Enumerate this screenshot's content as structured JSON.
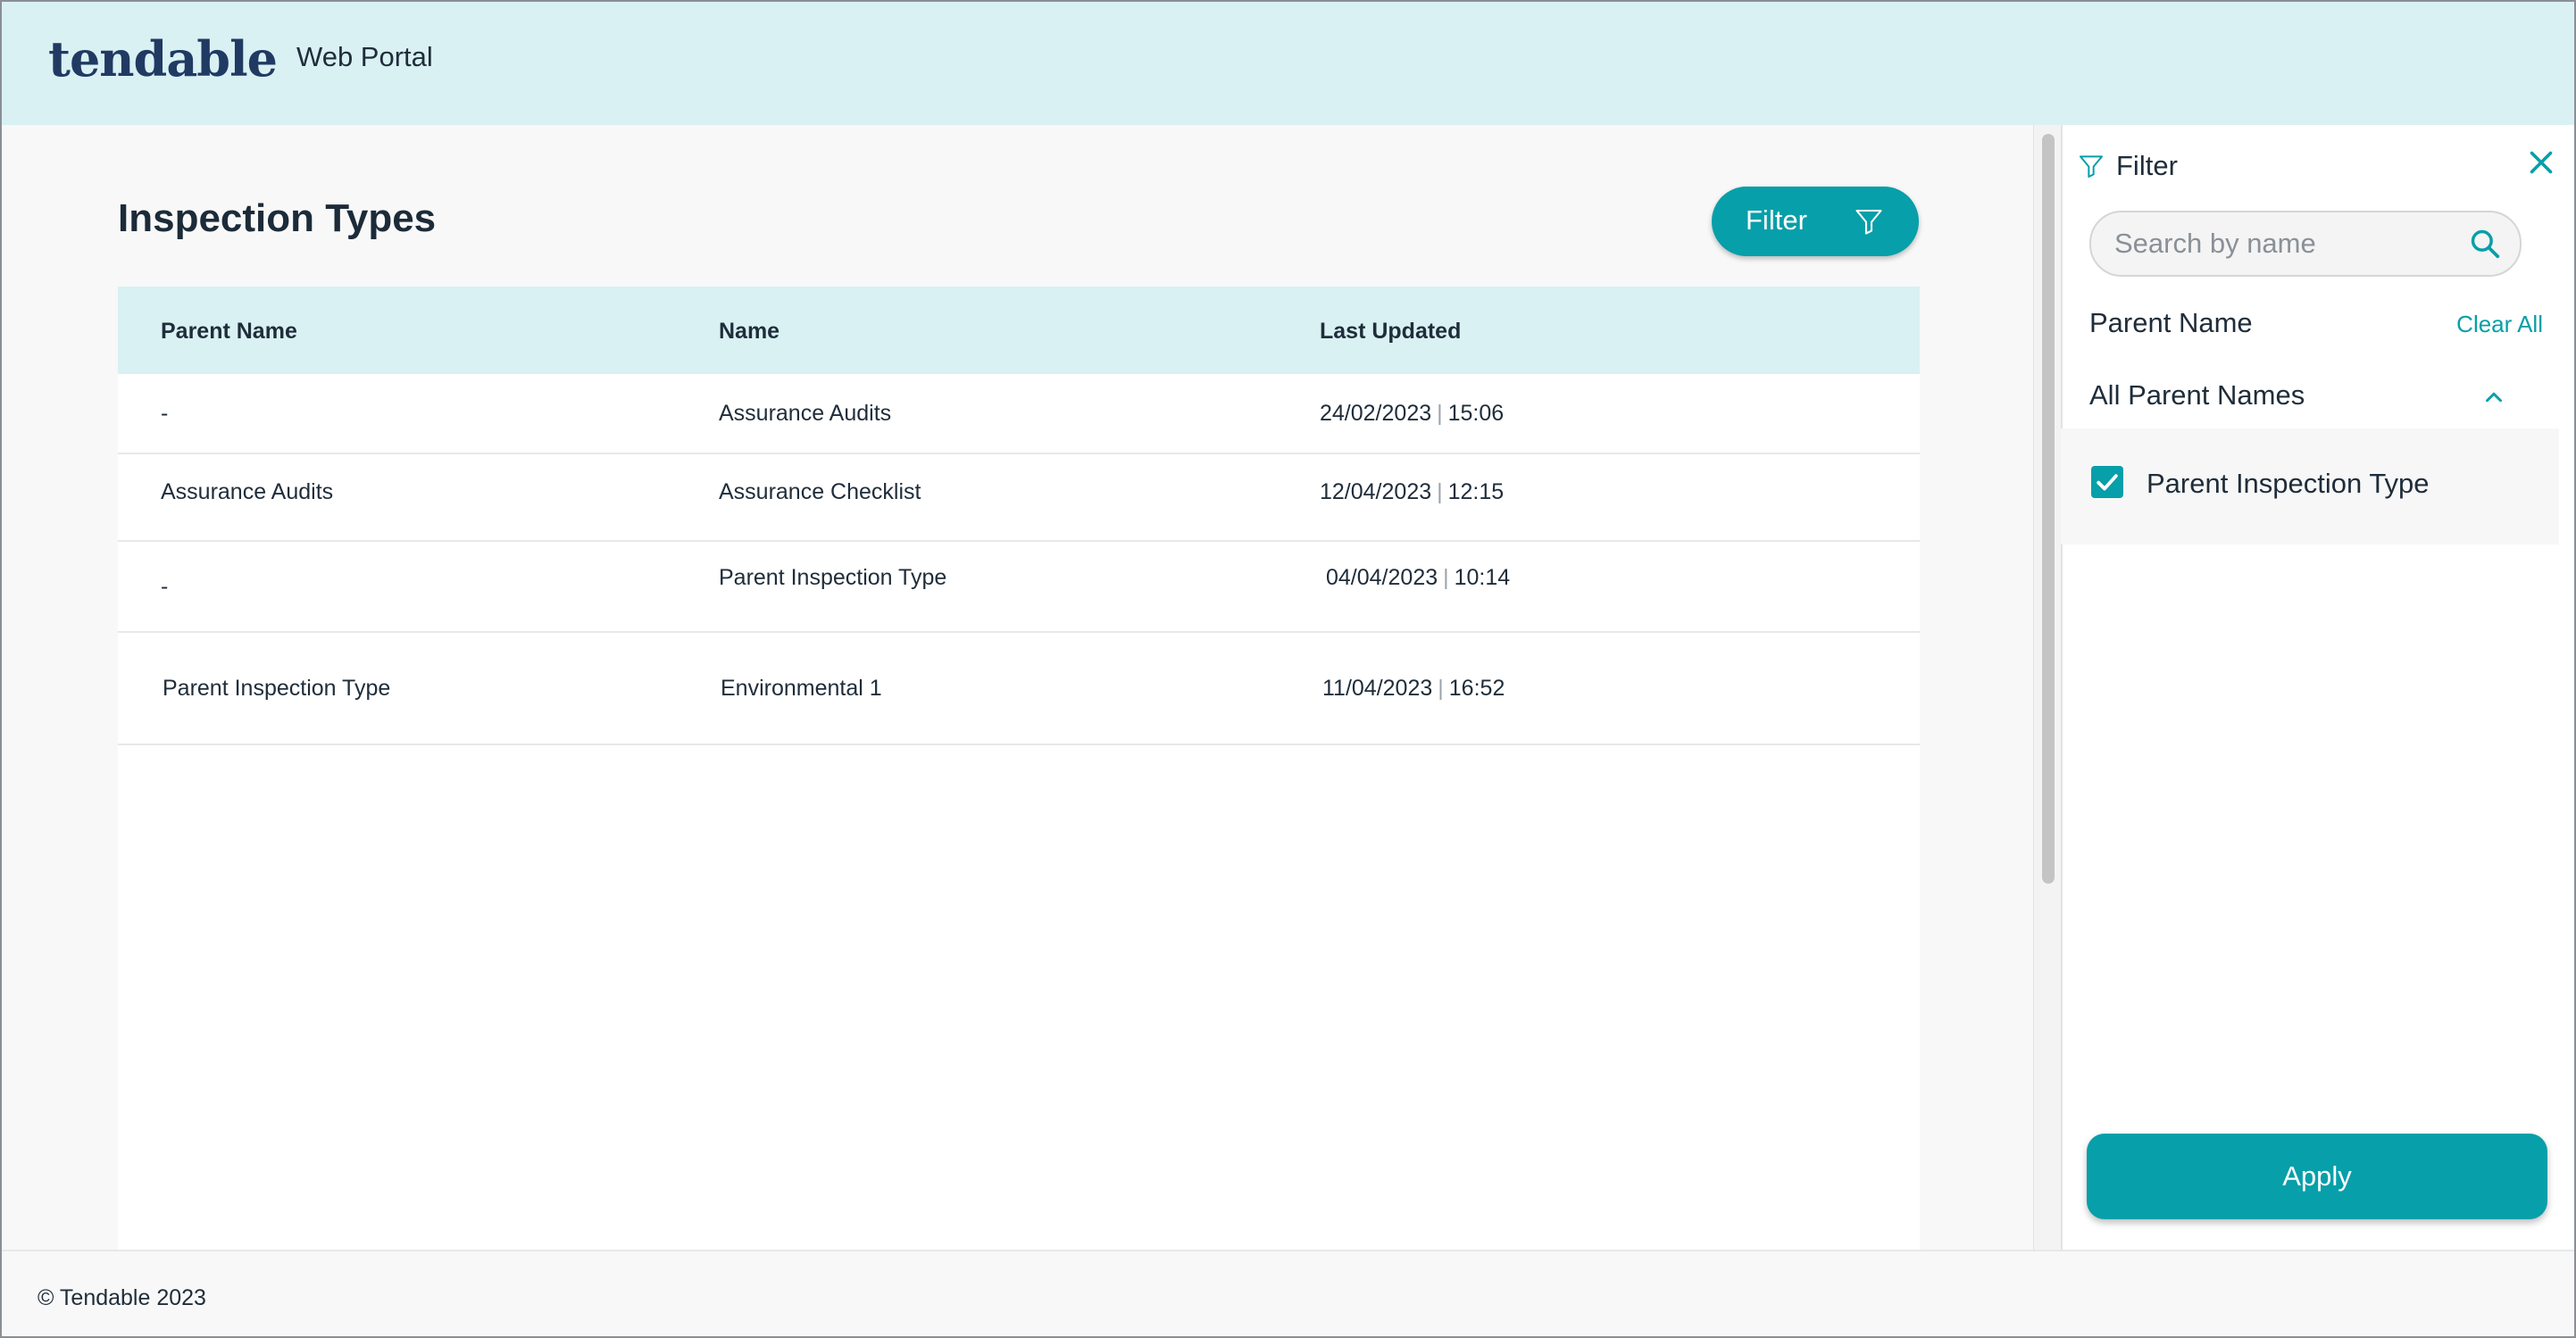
{
  "header": {
    "logo": "tendable",
    "portal_label": "Web Portal"
  },
  "main": {
    "title": "Inspection Types",
    "filter_button_label": "Filter",
    "table": {
      "columns": [
        "Parent Name",
        "Name",
        "Last Updated"
      ],
      "rows": [
        {
          "parent": "-",
          "name": "Assurance Audits",
          "date": "24/02/2023",
          "time": "15:06"
        },
        {
          "parent": "Assurance Audits",
          "name": "Assurance Checklist",
          "date": "12/04/2023",
          "time": "12:15"
        },
        {
          "parent": "-",
          "name": "Parent Inspection Type",
          "date": "04/04/2023",
          "time": "10:14"
        },
        {
          "parent": "Parent Inspection Type",
          "name": "Environmental 1",
          "date": "11/04/2023",
          "time": "16:52"
        }
      ]
    }
  },
  "filter_panel": {
    "title": "Filter",
    "search_placeholder": "Search by name",
    "parent_name_label": "Parent Name",
    "clear_all_label": "Clear All",
    "all_parent_names_label": "All Parent Names",
    "options": [
      {
        "label": "Parent Inspection Type",
        "checked": true
      }
    ],
    "apply_label": "Apply"
  },
  "footer": {
    "copyright": "© Tendable 2023"
  },
  "colors": {
    "accent": "#079fa9",
    "header_bg": "#d9f1f3",
    "text": "#1f2d3a",
    "logo": "#203a63"
  },
  "icons": {
    "filter": "filter-funnel-icon",
    "close": "close-icon",
    "search": "search-icon",
    "chevron": "chevron-up-icon",
    "checkbox": "checkbox-checked-icon"
  }
}
